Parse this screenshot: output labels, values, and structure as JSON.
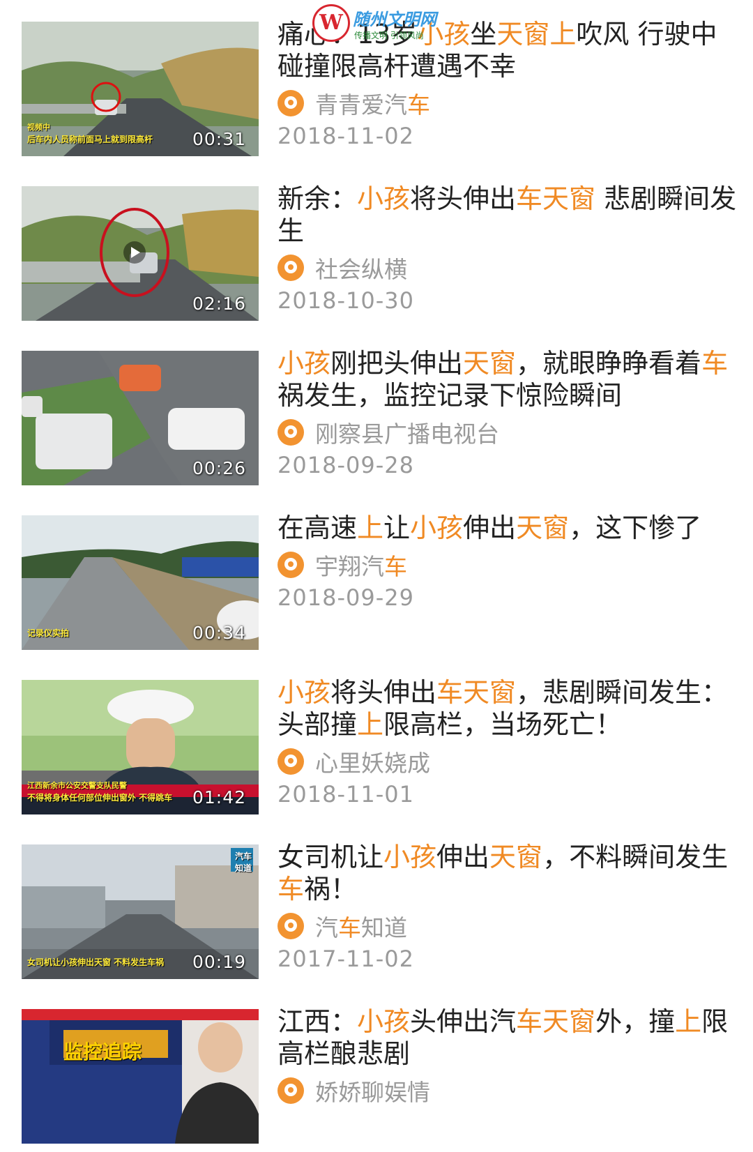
{
  "watermark": {
    "logo_text": "W",
    "title": "随州文明网",
    "subtitle": "传播文明  引领风尚"
  },
  "colors": {
    "highlight": "#f08a24",
    "title_text": "#222222",
    "meta_text": "#9a9a9a",
    "source_icon": "#f29330"
  },
  "videos": [
    {
      "title_segments": [
        {
          "text": "痛心：13岁",
          "hl": false
        },
        {
          "text": "小孩",
          "hl": true
        },
        {
          "text": "坐",
          "hl": false
        },
        {
          "text": "天窗上",
          "hl": true
        },
        {
          "text": "吹风 行驶中碰撞限高杆遭遇不幸",
          "hl": false
        }
      ],
      "source_segments": [
        {
          "text": "青青爱汽",
          "hl": false
        },
        {
          "text": "车",
          "hl": true
        }
      ],
      "date": "2018-11-02",
      "duration": "00:31",
      "thumb_caption": "后车内人员称前面马上就到限高杆",
      "thumb_caption_top": "视频中"
    },
    {
      "title_segments": [
        {
          "text": "新余：",
          "hl": false
        },
        {
          "text": "小孩",
          "hl": true
        },
        {
          "text": "将头伸出",
          "hl": false
        },
        {
          "text": "车天窗",
          "hl": true
        },
        {
          "text": " 悲剧瞬间发生",
          "hl": false
        }
      ],
      "source_segments": [
        {
          "text": "社会纵横",
          "hl": false
        }
      ],
      "date": "2018-10-30",
      "duration": "02:16",
      "thumb_caption": "",
      "thumb_caption_top": ""
    },
    {
      "title_segments": [
        {
          "text": "小孩",
          "hl": true
        },
        {
          "text": "刚把头伸出",
          "hl": false
        },
        {
          "text": "天窗",
          "hl": true
        },
        {
          "text": "，就眼睁睁看着",
          "hl": false
        },
        {
          "text": "车",
          "hl": true
        },
        {
          "text": "祸发生，监控记录下惊险瞬间",
          "hl": false
        }
      ],
      "source_segments": [
        {
          "text": "刚察县广播电视台",
          "hl": false
        }
      ],
      "date": "2018-09-28",
      "duration": "00:26",
      "thumb_caption": "",
      "thumb_caption_top": ""
    },
    {
      "title_segments": [
        {
          "text": "在高速",
          "hl": false
        },
        {
          "text": "上",
          "hl": true
        },
        {
          "text": "让",
          "hl": false
        },
        {
          "text": "小孩",
          "hl": true
        },
        {
          "text": "伸出",
          "hl": false
        },
        {
          "text": "天窗",
          "hl": true
        },
        {
          "text": "，这下惨了",
          "hl": false
        }
      ],
      "source_segments": [
        {
          "text": "宇翔汽",
          "hl": false
        },
        {
          "text": "车",
          "hl": true
        }
      ],
      "date": "2018-09-29",
      "duration": "00:34",
      "thumb_caption": "记录仪实拍",
      "thumb_caption_top": ""
    },
    {
      "title_segments": [
        {
          "text": "小孩",
          "hl": true
        },
        {
          "text": "将头伸出",
          "hl": false
        },
        {
          "text": "车天窗",
          "hl": true
        },
        {
          "text": "，悲剧瞬间发生：头部撞",
          "hl": false
        },
        {
          "text": "上",
          "hl": true
        },
        {
          "text": "限高栏，当场死亡！",
          "hl": false
        }
      ],
      "source_segments": [
        {
          "text": "心里妖娆成",
          "hl": false
        }
      ],
      "date": "2018-11-01",
      "duration": "01:42",
      "thumb_caption": "不得将身体任何部位伸出窗外 不得跳车",
      "thumb_caption_top": "江西新余市公安交警支队民警"
    },
    {
      "title_segments": [
        {
          "text": "女司机让",
          "hl": false
        },
        {
          "text": "小孩",
          "hl": true
        },
        {
          "text": "伸出",
          "hl": false
        },
        {
          "text": "天窗",
          "hl": true
        },
        {
          "text": "，不料瞬间发生",
          "hl": false
        },
        {
          "text": "车",
          "hl": true
        },
        {
          "text": "祸！",
          "hl": false
        }
      ],
      "source_segments": [
        {
          "text": "汽",
          "hl": false
        },
        {
          "text": "车",
          "hl": true
        },
        {
          "text": "知道",
          "hl": false
        }
      ],
      "date": "2017-11-02",
      "duration": "00:19",
      "thumb_caption": "女司机让小孩伸出天窗 不料发生车祸",
      "thumb_caption_top": "汽车知道"
    },
    {
      "title_segments": [
        {
          "text": "江西：",
          "hl": false
        },
        {
          "text": "小孩",
          "hl": true
        },
        {
          "text": "头伸出汽",
          "hl": false
        },
        {
          "text": "车天窗",
          "hl": true
        },
        {
          "text": "外，撞",
          "hl": false
        },
        {
          "text": "上",
          "hl": true
        },
        {
          "text": "限高栏酿悲剧",
          "hl": false
        }
      ],
      "source_segments": [
        {
          "text": "娇娇聊娱情",
          "hl": false
        }
      ],
      "date": "",
      "duration": "",
      "thumb_caption": "监控追踪",
      "thumb_caption_top": ""
    }
  ]
}
